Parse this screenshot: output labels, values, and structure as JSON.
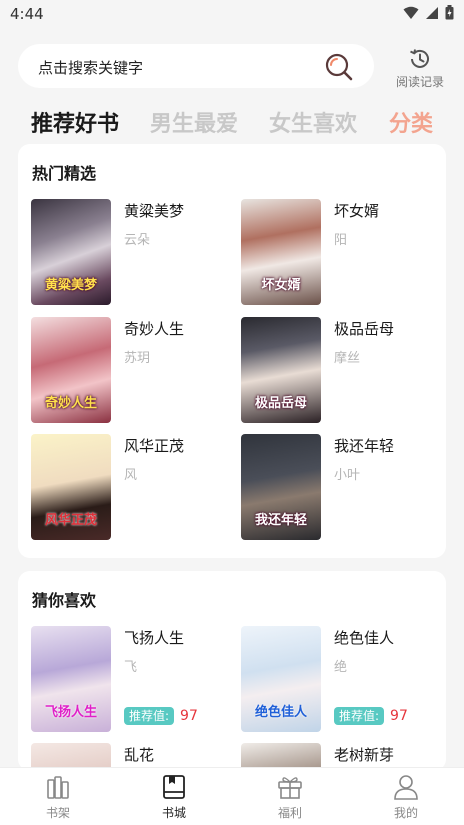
{
  "status": {
    "time": "4:44"
  },
  "search": {
    "placeholder": "点击搜索关键字",
    "history_label": "阅读记录"
  },
  "tabs": [
    {
      "label": "推荐好书",
      "state": "active"
    },
    {
      "label": "男生最爱",
      "state": "inactive"
    },
    {
      "label": "女生喜欢",
      "state": "inactive"
    },
    {
      "label": "分类",
      "state": "accent"
    }
  ],
  "hot": {
    "title": "热门精选",
    "books": [
      {
        "name": "黄粱美梦",
        "author": "云朵",
        "cover_text": "黄粱美梦"
      },
      {
        "name": "坏女婿",
        "author": "阳",
        "cover_text": "坏女婿"
      },
      {
        "name": "奇妙人生",
        "author": "苏玥",
        "cover_text": "奇妙人生"
      },
      {
        "name": "极品岳母",
        "author": "摩丝",
        "cover_text": "极品岳母"
      },
      {
        "name": "风华正茂",
        "author": "风",
        "cover_text": "风华正茂"
      },
      {
        "name": "我还年轻",
        "author": "小叶",
        "cover_text": "我还年轻"
      }
    ]
  },
  "guess": {
    "title": "猜你喜欢",
    "rec_label": "推荐值:",
    "books": [
      {
        "name": "飞扬人生",
        "author": "飞",
        "rec_value": "97",
        "cover_text": "飞扬人生"
      },
      {
        "name": "绝色佳人",
        "author": "绝",
        "rec_value": "97",
        "cover_text": "绝色佳人"
      },
      {
        "name": "乱花",
        "author": "",
        "rec_value": "",
        "cover_text": ""
      },
      {
        "name": "老树新芽",
        "author": "",
        "rec_value": "",
        "cover_text": ""
      }
    ]
  },
  "nav": [
    {
      "label": "书架",
      "icon": "bookshelf-icon",
      "active": false
    },
    {
      "label": "书城",
      "icon": "bookstore-icon",
      "active": true
    },
    {
      "label": "福利",
      "icon": "gift-icon",
      "active": false
    },
    {
      "label": "我的",
      "icon": "profile-icon",
      "active": false
    }
  ],
  "colors": {
    "accent_tab": "#f3a48f",
    "rec_badge": "#58c9c2",
    "rec_value": "#e6363c"
  }
}
